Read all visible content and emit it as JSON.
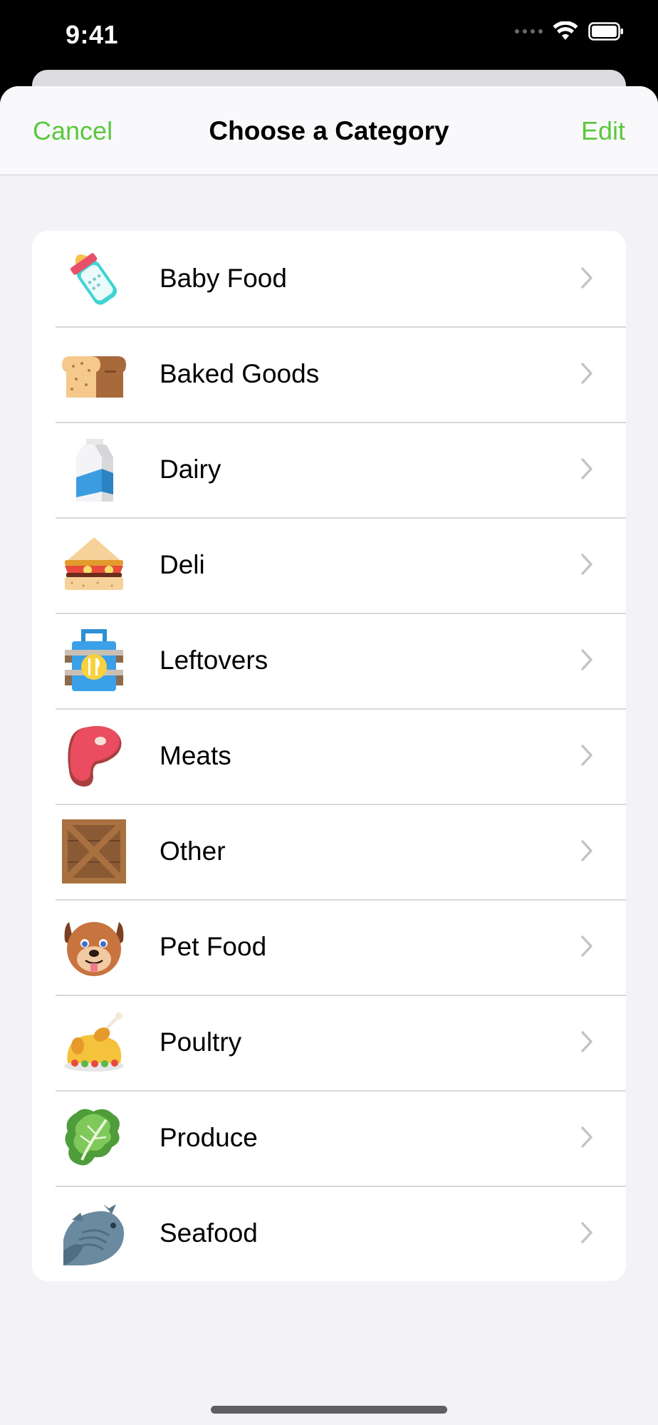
{
  "status_bar": {
    "time": "9:41"
  },
  "nav": {
    "cancel_label": "Cancel",
    "title": "Choose a Category",
    "edit_label": "Edit"
  },
  "accent_color": "#5ac83c",
  "categories": [
    {
      "label": "Baby Food",
      "icon": "baby-bottle-icon"
    },
    {
      "label": "Baked Goods",
      "icon": "bread-icon"
    },
    {
      "label": "Dairy",
      "icon": "milk-carton-icon"
    },
    {
      "label": "Deli",
      "icon": "sandwich-icon"
    },
    {
      "label": "Leftovers",
      "icon": "lunchbox-icon"
    },
    {
      "label": "Meats",
      "icon": "steak-icon"
    },
    {
      "label": "Other",
      "icon": "crate-icon"
    },
    {
      "label": "Pet Food",
      "icon": "dog-icon"
    },
    {
      "label": "Poultry",
      "icon": "roast-chicken-icon"
    },
    {
      "label": "Produce",
      "icon": "lettuce-icon"
    },
    {
      "label": "Seafood",
      "icon": "fish-icon"
    }
  ]
}
